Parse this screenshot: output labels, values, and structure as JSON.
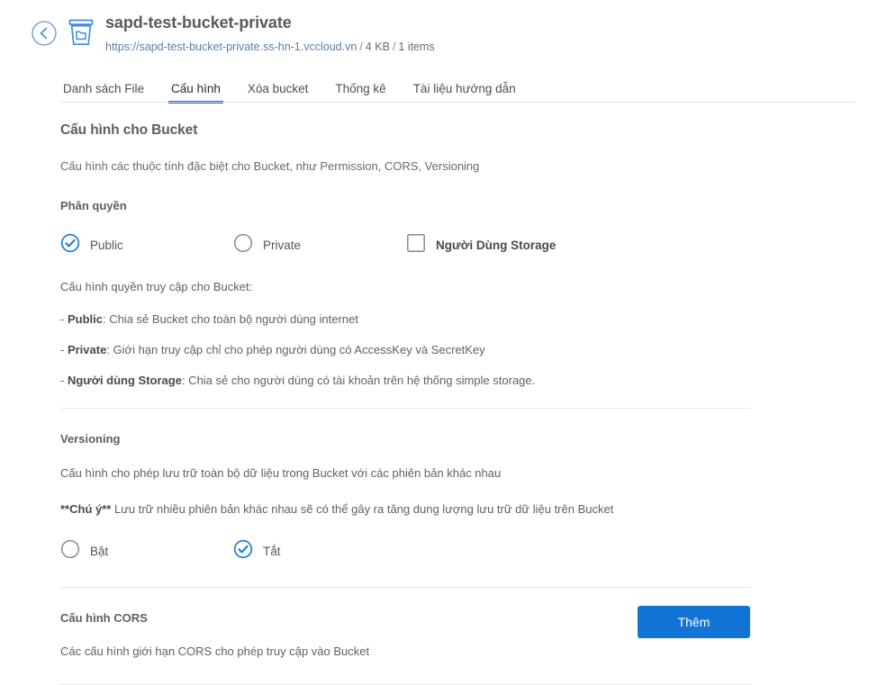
{
  "header": {
    "back_icon": "back-arrow-icon",
    "bucket_icon": "bucket-folder-icon",
    "title": "sapd-test-bucket-private",
    "url": "https://sapd-test-bucket-private.ss-hn-1.vccloud.vn",
    "sep": "/",
    "size": "4 KB",
    "items": "1 items"
  },
  "tabs": [
    {
      "label": "Danh sách File",
      "active": false
    },
    {
      "label": "Cấu hình",
      "active": true
    },
    {
      "label": "Xóa bucket",
      "active": false
    },
    {
      "label": "Thống kê",
      "active": false
    },
    {
      "label": "Tài liệu hướng dẫn",
      "active": false
    }
  ],
  "main": {
    "section_title": "Cấu hình cho Bucket",
    "section_desc": "Cấu hình các thuộc tính đặc biệt cho Bucket, như Permission, CORS, Versioning",
    "permission": {
      "label": "Phân quyền",
      "options": [
        {
          "label": "Public",
          "type": "radio",
          "checked": true
        },
        {
          "label": "Private",
          "type": "radio",
          "checked": false
        },
        {
          "label": "Người Dùng Storage",
          "type": "checkbox",
          "checked": false
        }
      ],
      "intro": "Cấu hình quyền truy cập cho Bucket:",
      "bullets": [
        {
          "prefix": "- ",
          "term": "Public",
          "rest": ": Chia sẻ Bucket cho toàn bộ người dùng internet"
        },
        {
          "prefix": "- ",
          "term": "Private",
          "rest": ": Giới hạn truy cập chỉ cho phép người dùng có AccessKey và SecretKey"
        },
        {
          "prefix": "- ",
          "term": "Người dùng Storage",
          "rest": ": Chia sẻ cho người dùng có tài khoản trên hệ thống simple storage."
        }
      ]
    },
    "versioning": {
      "label": "Versioning",
      "desc": "Cấu hình cho phép lưu trữ toàn bộ dữ liệu trong Bucket với các phiên bản khác nhau",
      "note_bold": "**Chú ý**",
      "note_rest": " Lưu trữ nhiều phiên bản khác nhau sẽ có thể gây ra tăng dung lượng lưu trữ dữ liệu trên Bucket",
      "options": [
        {
          "label": "Bật",
          "type": "radio",
          "checked": false
        },
        {
          "label": "Tắt",
          "type": "radio",
          "checked": true
        }
      ]
    },
    "cors": {
      "title": "Cấu hình CORS",
      "desc": "Các cấu hình giới hạn CORS cho phép truy cập vào Bucket",
      "add_button": "Thêm"
    }
  },
  "colors": {
    "accent": "#1668c1",
    "button": "#1274d4",
    "icon_blue": "#3f8de0",
    "text": "#5a5a5a",
    "divider": "#e8e8e8"
  }
}
